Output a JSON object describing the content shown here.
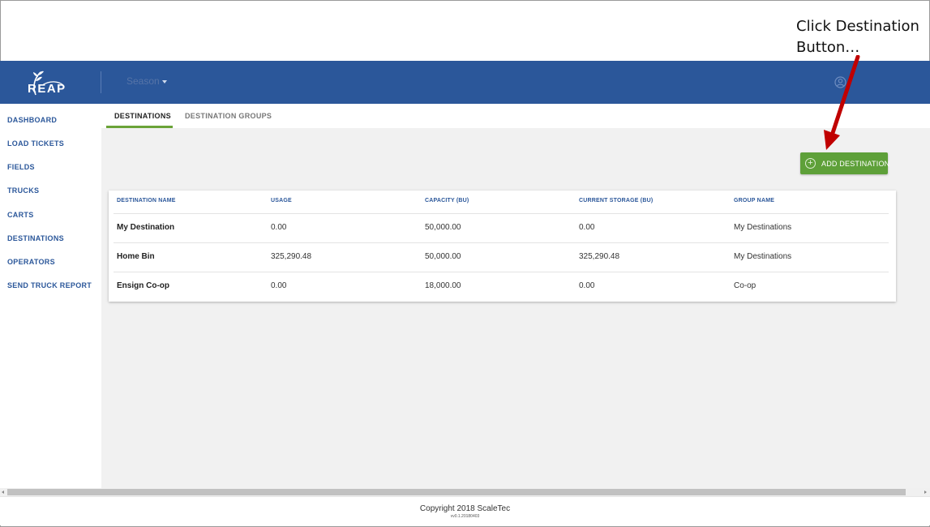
{
  "annotation": {
    "line1": "Click Destination",
    "line2": "Button…"
  },
  "app": {
    "logo_text": "REAP",
    "season_label": "Season",
    "brand_color": "#2b579a",
    "accent_color": "#5ea039"
  },
  "sidebar": {
    "items": [
      {
        "label": "DASHBOARD"
      },
      {
        "label": "LOAD TICKETS"
      },
      {
        "label": "FIELDS"
      },
      {
        "label": "TRUCKS"
      },
      {
        "label": "CARTS"
      },
      {
        "label": "DESTINATIONS"
      },
      {
        "label": "OPERATORS"
      },
      {
        "label": "SEND TRUCK REPORT"
      }
    ]
  },
  "tabs": {
    "active": "DESTINATIONS",
    "inactive": "DESTINATION GROUPS"
  },
  "toolbar": {
    "add_label": "ADD DESTINATION",
    "add_icon": "plus-circle-icon"
  },
  "table": {
    "headers": [
      "DESTINATION NAME",
      "USAGE",
      "CAPACITY (BU)",
      "CURRENT STORAGE (BU)",
      "GROUP NAME"
    ],
    "rows": [
      {
        "name": "My Destination",
        "usage": "0.00",
        "capacity": "50,000.00",
        "storage": "0.00",
        "group": "My Destinations"
      },
      {
        "name": "Home Bin",
        "usage": "325,290.48",
        "capacity": "50,000.00",
        "storage": "325,290.48",
        "group": "My Destinations"
      },
      {
        "name": "Ensign Co-op",
        "usage": "0.00",
        "capacity": "18,000.00",
        "storage": "0.00",
        "group": "Co-op"
      }
    ]
  },
  "footer": {
    "copyright": "Copyright 2018 ScaleTec",
    "version": "vv0.1.20180403"
  }
}
